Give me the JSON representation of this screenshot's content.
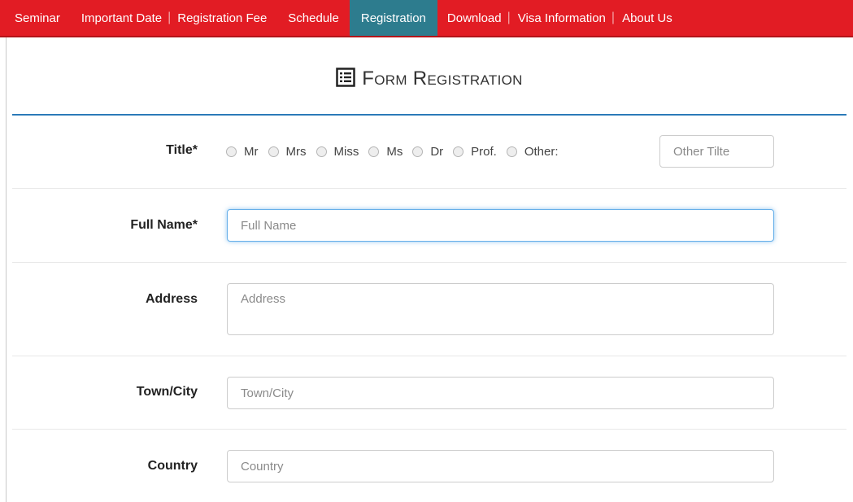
{
  "nav": {
    "items": [
      {
        "label": "Seminar",
        "active": false
      },
      {
        "label": "Important Date",
        "active": false
      },
      {
        "label": "Registration Fee",
        "active": false
      },
      {
        "label": "Schedule",
        "active": false
      },
      {
        "label": "Registration",
        "active": true
      },
      {
        "label": "Download",
        "active": false
      },
      {
        "label": "Visa Information",
        "active": false
      },
      {
        "label": "About Us",
        "active": false
      }
    ],
    "separator": "|"
  },
  "form": {
    "title": "Form Registration",
    "title_field": {
      "label": "Title*",
      "options": [
        "Mr",
        "Mrs",
        "Miss",
        "Ms",
        "Dr",
        "Prof.",
        "Other:"
      ],
      "other_placeholder": "Other Tilte"
    },
    "full_name": {
      "label": "Full Name*",
      "placeholder": "Full Name"
    },
    "address": {
      "label": "Address",
      "placeholder": "Address"
    },
    "town_city": {
      "label": "Town/City",
      "placeholder": "Town/City"
    },
    "country": {
      "label": "Country",
      "placeholder": "Country"
    }
  },
  "colors": {
    "nav_bg": "#e21c24",
    "nav_active": "#2d7c8e",
    "header_rule": "#2b7ab8",
    "focus": "#66afe9"
  }
}
